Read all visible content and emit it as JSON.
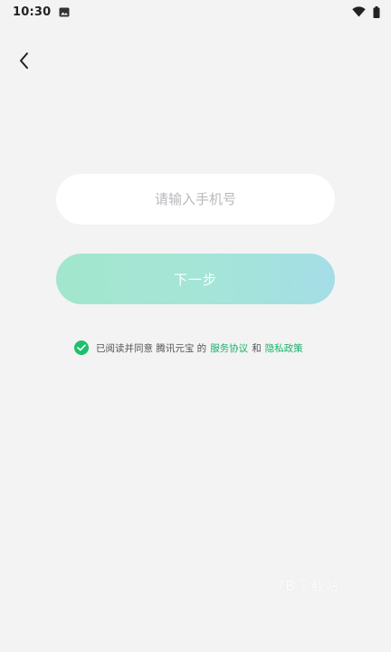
{
  "status_bar": {
    "time": "10:30",
    "icons": [
      "notification-image-icon",
      "wifi-icon",
      "battery-icon"
    ]
  },
  "nav": {
    "back_icon": "chevron-left-icon"
  },
  "form": {
    "phone_placeholder": "请输入手机号",
    "phone_value": "",
    "next_label": "下一步"
  },
  "agreement": {
    "prefix": "已阅读并同意 腾讯元宝 的",
    "service_link": "服务协议",
    "and": "和",
    "privacy_link": "隐私政策",
    "checked": true
  },
  "watermark": "7B下载站",
  "colors": {
    "background": "#f3f3f4",
    "input_bg": "#ffffff",
    "button_gradient_start": "#a3e6cd",
    "button_gradient_end": "#a5dde6",
    "accent_green": "#17b26a"
  }
}
